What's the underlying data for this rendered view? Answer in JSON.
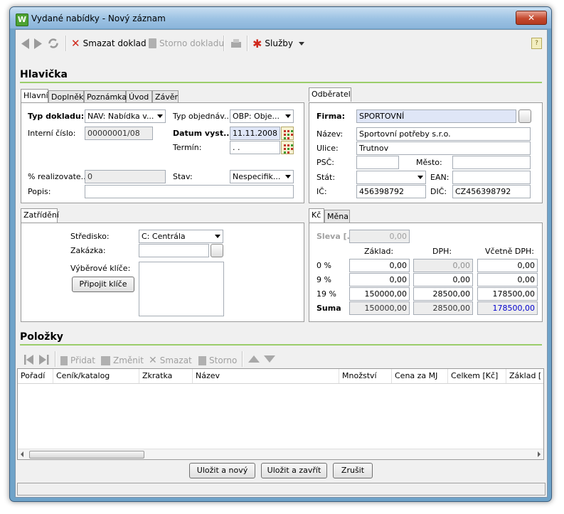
{
  "window": {
    "title": "Vydané nabídky - Nový záznam",
    "app_icon_letter": "W"
  },
  "toolbar": {
    "delete_label": "Smazat doklad",
    "cancel_label": "Storno dokladu",
    "services_label": "Služby"
  },
  "hlavicka": {
    "title": "Hlavička",
    "tabs": [
      "Hlavní",
      "Doplněk",
      "Poznámka",
      "Úvod",
      "Závěr"
    ],
    "typ_dokladu_label": "Typ dokladu:",
    "typ_dokladu_value": "NAV: Nabídka v...",
    "typ_objednavky_label": "Typ objednáv...",
    "typ_objednavky_value": "OBP: Obje...",
    "interni_cislo_label": "Interní číslo:",
    "interni_cislo_value": "00000001/08",
    "datum_label": "Datum vyst...",
    "datum_value": "11.11.2008",
    "termin_label": "Termín:",
    "termin_value": ". .",
    "realizovat_label": "% realizovate...",
    "realizovat_value": "0",
    "stav_label": "Stav:",
    "stav_value": "Nespecifik...",
    "popis_label": "Popis:",
    "popis_value": ""
  },
  "odberatel": {
    "tab": "Odběratel",
    "firma_label": "Firma:",
    "firma_value": "SPORTOVNÍ",
    "nazev_label": "Název:",
    "nazev_value": "Sportovní potřeby s.r.o.",
    "ulice_label": "Ulice:",
    "ulice_value": "Trutnov",
    "psc_label": "PSČ:",
    "psc_value": "",
    "mesto_label": "Město:",
    "mesto_value": "",
    "stat_label": "Stát:",
    "stat_value": "",
    "ean_label": "EAN:",
    "ean_value": "",
    "ic_label": "IČ:",
    "ic_value": "456398792",
    "dic_label": "DIČ:",
    "dic_value": "CZ456398792"
  },
  "zatrideni": {
    "tab": "Zatřídění",
    "stredisko_label": "Středisko:",
    "stredisko_value": "C: Centrála",
    "zakazka_label": "Zakázka:",
    "zakazka_value": "",
    "klice_label": "Výběrové klíče:",
    "pripojit_label": "Připojit klíče"
  },
  "sumy": {
    "tabs": [
      "Kč",
      "Měna"
    ],
    "sleva_label": "Sleva [..",
    "sleva_value": "0,00",
    "col_zaklad": "Základ:",
    "col_dph": "DPH:",
    "col_vcetne": "Včetně DPH:",
    "rows": [
      {
        "label": "0 %",
        "zaklad": "0,00",
        "dph": "0,00",
        "vcetne": "0,00"
      },
      {
        "label": "9 %",
        "zaklad": "0,00",
        "dph": "0,00",
        "vcetne": "0,00"
      },
      {
        "label": "19 %",
        "zaklad": "150000,00",
        "dph": "28500,00",
        "vcetne": "178500,00"
      },
      {
        "label": "Suma",
        "zaklad": "150000,00",
        "dph": "28500,00",
        "vcetne": "178500,00"
      }
    ],
    "suma_color": "#0000cc"
  },
  "polozky": {
    "title": "Položky",
    "add_label": "Přidat",
    "edit_label": "Změnit",
    "delete_label": "Smazat",
    "storno_label": "Storno",
    "columns": [
      "Pořadí",
      "Ceník/katalog",
      "Zkratka",
      "Název",
      "Množství",
      "Cena za MJ",
      "Celkem [Kč]",
      "Základ ["
    ]
  },
  "footer": {
    "save_new_label": "Uložit a nový",
    "save_close_label": "Uložit a zavřít",
    "cancel_label": "Zrušit"
  },
  "colors": {
    "accent_line": "#9acd6a",
    "title_blue": "#9cc2e3",
    "close_red": "#c4492e"
  }
}
